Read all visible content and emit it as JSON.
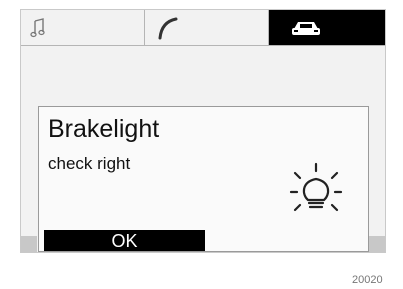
{
  "tabs": [
    {
      "icon": "music-note-icon"
    },
    {
      "icon": "phone-icon"
    },
    {
      "icon": "car-icon",
      "active": true
    }
  ],
  "dialog": {
    "title": "Brakelight",
    "message": "check right",
    "icon": "lightbulb-icon",
    "ok_label": "OK"
  },
  "image_code": "20020",
  "colors": {
    "active_tab_bg": "#000000",
    "button_bg": "#000000",
    "button_text": "#ffffff"
  }
}
